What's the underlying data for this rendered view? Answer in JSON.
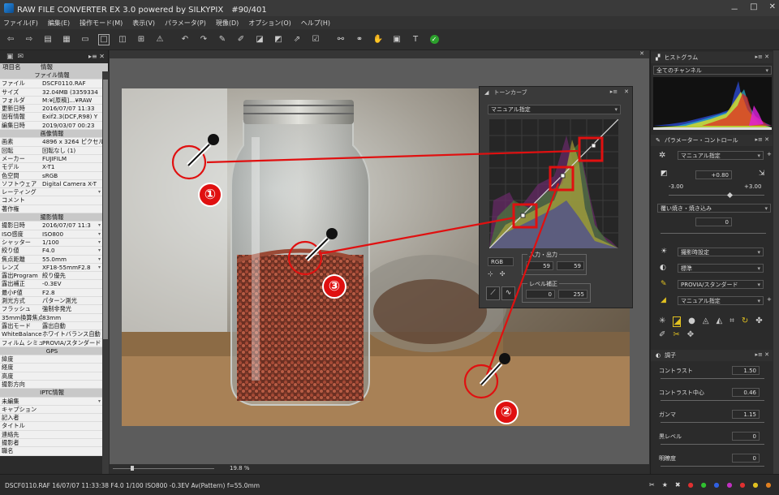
{
  "window": {
    "title": "RAW FILE CONVERTER EX 3.0 powered by SILKYPIX　#90/401",
    "controls": [
      "－",
      "□",
      "✕"
    ]
  },
  "menu": [
    "ファイル(F)",
    "編集(E)",
    "操作モード(M)",
    "表示(V)",
    "パラメータ(P)",
    "現像(D)",
    "オプション(O)",
    "ヘルプ(H)"
  ],
  "info_panel": {
    "header_key": "項目名",
    "header_value": "情報",
    "rows": [
      {
        "type": "section",
        "k": "ファイル情報"
      },
      {
        "k": "ファイル",
        "v": "DSCF0110.RAF"
      },
      {
        "k": "サイズ",
        "v": "32.04MB (3359334"
      },
      {
        "k": "フォルダ",
        "v": "M:¥[原稿]…¥RAW"
      },
      {
        "k": "更新日時",
        "v": "2016/07/07 11:33"
      },
      {
        "k": "固有情報",
        "v": "Exif2.3(DCF,R98) Y"
      },
      {
        "k": "編集日時",
        "v": "2019/03/07 00:23"
      },
      {
        "type": "section",
        "k": "画像情報"
      },
      {
        "k": "画素",
        "v": "4896 x 3264 ピクセル"
      },
      {
        "k": "回転",
        "v": "回転なし (1)"
      },
      {
        "k": "メーカー",
        "v": "FUJIFILM"
      },
      {
        "k": "モデル",
        "v": "X-T1"
      },
      {
        "k": "色空間",
        "v": "sRGB"
      },
      {
        "k": "ソフトウェア",
        "v": "Digital Camera X-T"
      },
      {
        "k": "レーティング",
        "v": "",
        "dd": true
      },
      {
        "k": "コメント",
        "v": ""
      },
      {
        "k": "著作権",
        "v": ""
      },
      {
        "type": "section",
        "k": "撮影情報"
      },
      {
        "k": "撮影日時",
        "v": "2016/07/07 11:3",
        "dd": true
      },
      {
        "k": "ISO感度",
        "v": "ISO800",
        "dd": true
      },
      {
        "k": "シャッター",
        "v": "1/100",
        "dd": true
      },
      {
        "k": "絞り値",
        "v": "F4.0",
        "dd": true
      },
      {
        "k": "焦点距離",
        "v": "55.0mm",
        "dd": true
      },
      {
        "k": "レンズ",
        "v": "XF18-55mmF2.8",
        "dd": true
      },
      {
        "k": "露出Program",
        "v": "絞り優先"
      },
      {
        "k": "露出補正",
        "v": "-0.3EV"
      },
      {
        "k": "最小F値",
        "v": "F2.8"
      },
      {
        "k": "測光方式",
        "v": "パターン測光"
      },
      {
        "k": "フラッシュ",
        "v": "強制非発光"
      },
      {
        "k": "35mm換算焦点",
        "v": "83mm"
      },
      {
        "k": "露出モード",
        "v": "露出自動"
      },
      {
        "k": "WhiteBalance",
        "v": "ホワイトバランス自動"
      },
      {
        "k": "フィルム シミュレー",
        "v": "PROVIA/スタンダード"
      },
      {
        "type": "section",
        "k": "GPS"
      },
      {
        "k": "緯度",
        "v": ""
      },
      {
        "k": "経度",
        "v": ""
      },
      {
        "k": "高度",
        "v": ""
      },
      {
        "k": "撮影方向",
        "v": ""
      },
      {
        "type": "section",
        "k": "IPTC情報"
      },
      {
        "k": "未編集",
        "v": "",
        "dd": true
      },
      {
        "k": "キャプション",
        "v": ""
      },
      {
        "k": "記入者",
        "v": ""
      },
      {
        "k": "タイトル",
        "v": ""
      },
      {
        "k": "連絡先",
        "v": ""
      },
      {
        "k": "撮影者",
        "v": ""
      },
      {
        "k": "職名",
        "v": ""
      }
    ]
  },
  "canvas": {
    "zoom": "19.8",
    "zoom_unit": "%"
  },
  "tone_curve": {
    "title": "トーンカーブ",
    "preset": "マニュアル指定",
    "channel": "RGB",
    "io_label": "入力・出力",
    "input": "59",
    "output": "59",
    "level_label": "レベル補正",
    "level_low": "0",
    "level_high": "255"
  },
  "histogram": {
    "title": "ヒストグラム",
    "channel": "全てのチャンネル"
  },
  "param_control": {
    "title": "パラメーター・コントロール",
    "preset": "マニュアル指定",
    "exposure": "+0.80",
    "exp_min": "-3.00",
    "exp_max": "+3.00",
    "dodge_label": "覆い焼き・焼き込み",
    "dodge_value": "0",
    "shooting_setting": "撮影時設定",
    "standard": "標準",
    "film": "PROVIA/スタンダード",
    "manual": "マニュアル指定"
  },
  "tone": {
    "title": "調子",
    "rows": [
      {
        "label": "コントラスト",
        "value": "1.50"
      },
      {
        "label": "コントラスト中心",
        "value": "0.46"
      },
      {
        "label": "ガンマ",
        "value": "1.15"
      },
      {
        "label": "黒レベル",
        "value": "0"
      },
      {
        "label": "明瞭度",
        "value": "0"
      }
    ]
  },
  "statusbar": {
    "text": "DSCF0110.RAF 16/07/07 11:33:38 F4.0 1/100 ISO800 -0.3EV Av(Pattern) f=55.0mm"
  },
  "callouts": [
    "①",
    "②",
    "③"
  ],
  "colors": {
    "accent": "#e01010",
    "panel": "#2b2b2b",
    "canvas_bg": "#5c5c5c"
  }
}
